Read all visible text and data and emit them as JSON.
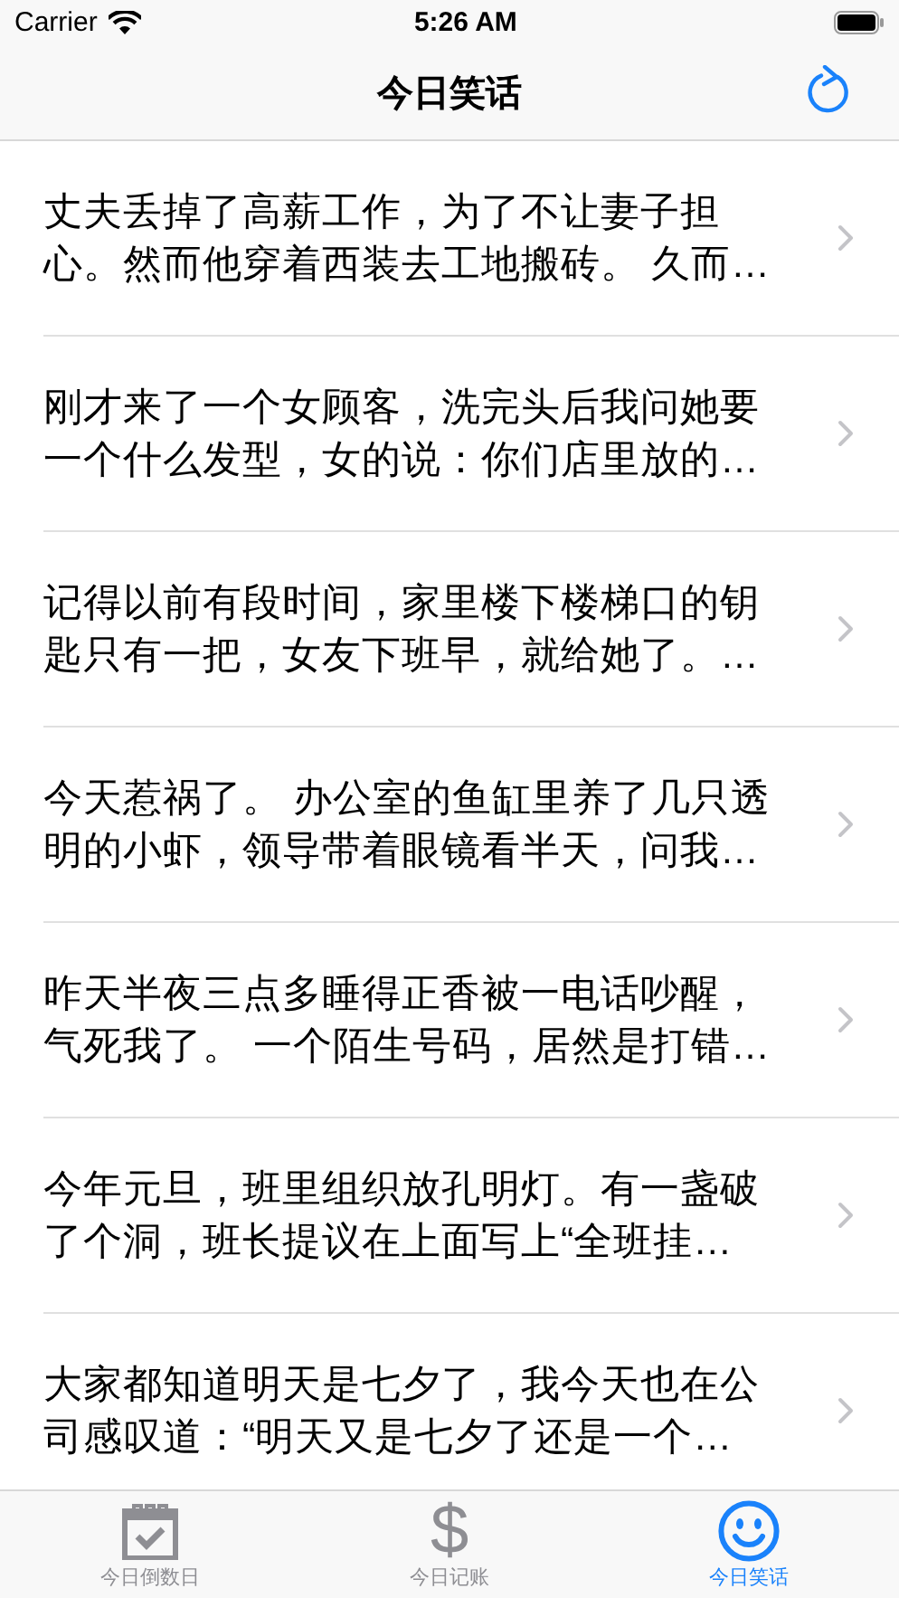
{
  "status_bar": {
    "carrier": "Carrier",
    "time": "5:26 AM"
  },
  "nav_bar": {
    "title": "今日笑话"
  },
  "jokes": [
    {
      "lines": [
        "丈夫丢掉了高薪工作，为了不让妻子担",
        "心。然而他穿着西装去工地搬砖。 久而…"
      ]
    },
    {
      "lines": [
        "刚才来了一个女顾客，洗完头后我问她要",
        "一个什么发型，女的说：你们店里放的…"
      ]
    },
    {
      "lines": [
        "记得以前有段时间，家里楼下楼梯口的钥",
        "匙只有一把，女友下班早，就给她了。…"
      ]
    },
    {
      "lines": [
        "今天惹祸了。 办公室的鱼缸里养了几只透",
        "明的小虾，领导带着眼镜看半天，问我…"
      ]
    },
    {
      "lines": [
        "昨天半夜三点多睡得正香被一电话吵醒，",
        "气死我了。 一个陌生号码，居然是打错…"
      ]
    },
    {
      "lines": [
        "今年元旦，班里组织放孔明灯。有一盏破",
        "了个洞，班长提议在上面写上“全班挂…"
      ]
    },
    {
      "lines": [
        "大家都知道明天是七夕了，我今天也在公",
        "司感叹道：“明天又是七夕了还是一个…"
      ]
    }
  ],
  "tabs": [
    {
      "kind": "calendar",
      "label": "今日倒数日",
      "selected": false
    },
    {
      "kind": "dollar",
      "glyph": "$",
      "label": "今日记账",
      "selected": false
    },
    {
      "kind": "smiley",
      "label": "今日笑话",
      "selected": true
    }
  ]
}
